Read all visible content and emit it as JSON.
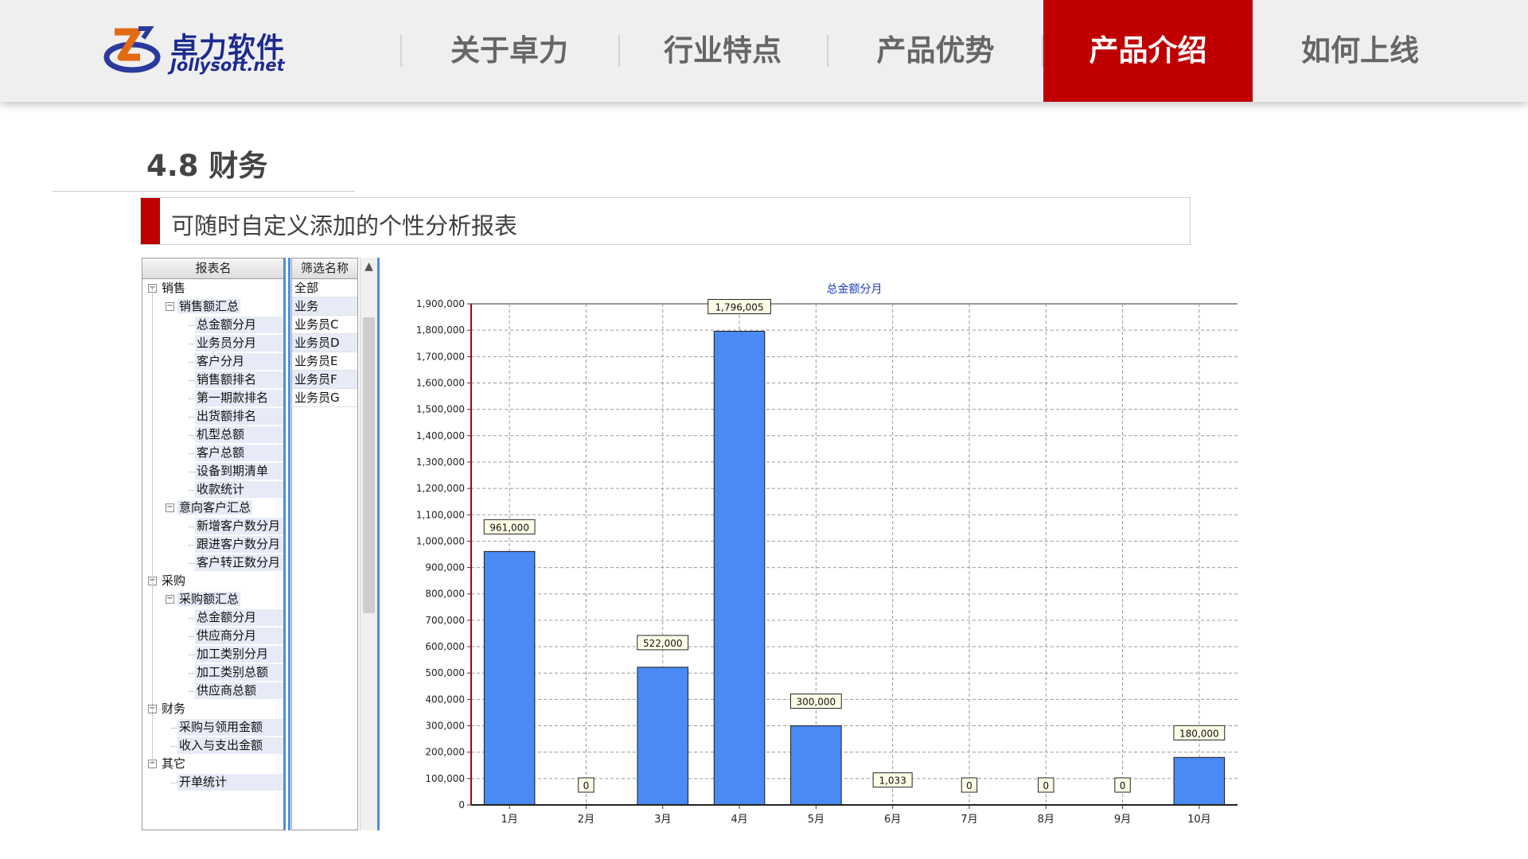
{
  "header": {
    "logo_cn": "卓力软件",
    "logo_en": "Jollysoft.net",
    "nav": [
      {
        "label": "关于卓力",
        "active": false
      },
      {
        "label": "行业特点",
        "active": false
      },
      {
        "label": "产品优势",
        "active": false
      },
      {
        "label": "产品介绍",
        "active": true
      },
      {
        "label": "如何上线",
        "active": false
      }
    ]
  },
  "section": {
    "title": "4.8 财务",
    "subtitle": "可随时自定义添加的个性分析报表"
  },
  "report_tree": {
    "header": "报表名",
    "rows": [
      {
        "label": "销售",
        "level": 0,
        "expander": true
      },
      {
        "label": "销售额汇总",
        "level": 1,
        "expander": true
      },
      {
        "label": "总金额分月",
        "level": 2
      },
      {
        "label": "业务员分月",
        "level": 2
      },
      {
        "label": "客户分月",
        "level": 2
      },
      {
        "label": "销售额排名",
        "level": 2
      },
      {
        "label": "第一期款排名",
        "level": 2
      },
      {
        "label": "出货额排名",
        "level": 2
      },
      {
        "label": "机型总额",
        "level": 2
      },
      {
        "label": "客户总额",
        "level": 2
      },
      {
        "label": "设备到期清单",
        "level": 2
      },
      {
        "label": "收款统计",
        "level": 2
      },
      {
        "label": "意向客户汇总",
        "level": 1,
        "expander": true
      },
      {
        "label": "新增客户数分月",
        "level": 2
      },
      {
        "label": "跟进客户数分月",
        "level": 2
      },
      {
        "label": "客户转正数分月",
        "level": 2
      },
      {
        "label": "采购",
        "level": 0,
        "expander": true
      },
      {
        "label": "采购额汇总",
        "level": 1,
        "expander": true
      },
      {
        "label": "总金额分月",
        "level": 2
      },
      {
        "label": "供应商分月",
        "level": 2
      },
      {
        "label": "加工类别分月",
        "level": 2
      },
      {
        "label": "加工类别总额",
        "level": 2
      },
      {
        "label": "供应商总额",
        "level": 2
      },
      {
        "label": "财务",
        "level": 0,
        "expander": true
      },
      {
        "label": "采购与领用金额",
        "level": 1
      },
      {
        "label": "收入与支出金额",
        "level": 1
      },
      {
        "label": "其它",
        "level": 0,
        "expander": true
      },
      {
        "label": "开单统计",
        "level": 1
      }
    ]
  },
  "filter_list": {
    "header": "筛选名称",
    "items": [
      "全部",
      "业务",
      "业务员C",
      "业务员D",
      "业务员E",
      "业务员F",
      "业务员G"
    ]
  },
  "chart_data": {
    "type": "bar",
    "title": "总金额分月",
    "categories": [
      "1月",
      "2月",
      "3月",
      "4月",
      "5月",
      "6月",
      "7月",
      "8月",
      "9月",
      "10月"
    ],
    "values": [
      961000,
      0,
      522000,
      1796005,
      300000,
      1033,
      0,
      0,
      0,
      180000
    ],
    "data_labels": [
      "961,000",
      "0",
      "522,000",
      "1,796,005",
      "300,000",
      "1,033",
      "0",
      "0",
      "0",
      "180,000"
    ],
    "yticks": [
      "0",
      "100,000",
      "200,000",
      "300,000",
      "400,000",
      "500,000",
      "600,000",
      "700,000",
      "800,000",
      "900,000",
      "1,000,000",
      "1,100,000",
      "1,200,000",
      "1,300,000",
      "1,400,000",
      "1,500,000",
      "1,600,000",
      "1,700,000",
      "1,800,000",
      "1,900,000"
    ],
    "ylim": [
      0,
      1900000
    ],
    "xlabel": "",
    "ylabel": "",
    "grid": true,
    "bar_color": "#4a8af4",
    "title_color": "#1f3fbf"
  },
  "colors": {
    "accent": "#c00000",
    "brand": "#1d2b8f",
    "header_bg": "#efefef",
    "selection_bg": "#e6ebf7"
  }
}
